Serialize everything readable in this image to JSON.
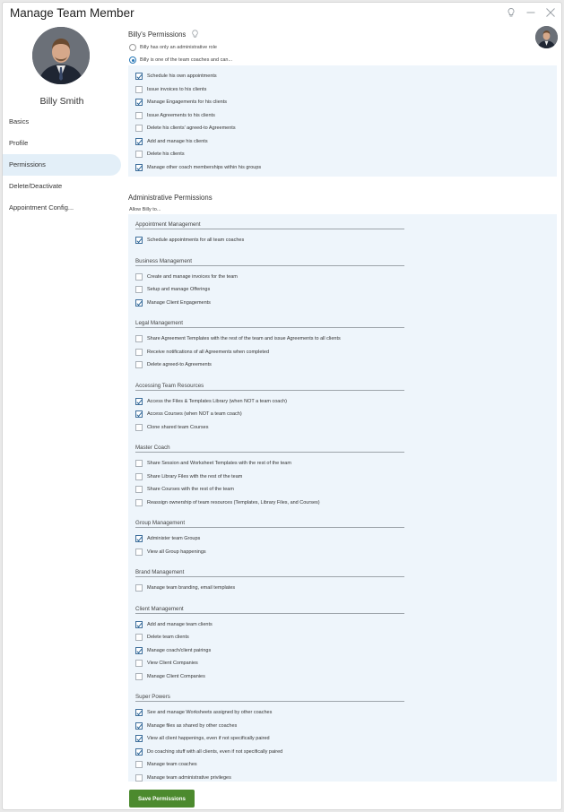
{
  "window": {
    "title": "Manage Team Member"
  },
  "user": {
    "name": "Billy Smith"
  },
  "nav": {
    "items": [
      "Basics",
      "Profile",
      "Permissions",
      "Delete/Deactivate",
      "Appointment Config..."
    ]
  },
  "coach_permissions": {
    "title": "Billy's Permissions",
    "radios": [
      {
        "label": "Billy has only an administrative role",
        "selected": false
      },
      {
        "label": "Billy is one of the team coaches and can...",
        "selected": true
      }
    ],
    "items": [
      {
        "label": "Schedule his own appointments",
        "checked": true
      },
      {
        "label": "Issue invoices to his clients",
        "checked": false
      },
      {
        "label": "Manage Engagements for his clients",
        "checked": true
      },
      {
        "label": "Issue Agreements to his clients",
        "checked": false
      },
      {
        "label": "Delete his clients' agreed-to Agreements",
        "checked": false
      },
      {
        "label": "Add and manage his clients",
        "checked": true
      },
      {
        "label": "Delete his clients",
        "checked": false
      },
      {
        "label": "Manage other coach memberships within his groups",
        "checked": true
      }
    ]
  },
  "admin_permissions": {
    "title": "Administrative Permissions",
    "subtitle": "Allow Billy to...",
    "groups": [
      {
        "name": "Appointment Management",
        "items": [
          {
            "label": "Schedule appointments for all team coaches",
            "checked": true
          }
        ]
      },
      {
        "name": "Business Management",
        "items": [
          {
            "label": "Create and manage invoices for the team",
            "checked": false
          },
          {
            "label": "Setup and manage Offerings",
            "checked": false
          },
          {
            "label": "Manage Client Engagements",
            "checked": true
          }
        ]
      },
      {
        "name": "Legal Management",
        "items": [
          {
            "label": "Share Agreement Templates with the rest of the team and issue Agreements to all clients",
            "checked": false
          },
          {
            "label": "Receive notifications of all Agreements when completed",
            "checked": false
          },
          {
            "label": "Delete agreed-to Agreements",
            "checked": false
          }
        ]
      },
      {
        "name": "Accessing Team Resources",
        "items": [
          {
            "label": "Access the Files & Templates Library (when NOT a team coach)",
            "checked": true
          },
          {
            "label": "Access Courses (when NOT a team coach)",
            "checked": true
          },
          {
            "label": "Clone shared team Courses",
            "checked": false
          }
        ]
      },
      {
        "name": "Master Coach",
        "items": [
          {
            "label": "Share Session and Worksheet Templates with the rest of the team",
            "checked": false
          },
          {
            "label": "Share Library Files with the rest of the team",
            "checked": false
          },
          {
            "label": "Share Courses with the rest of the team",
            "checked": false
          },
          {
            "label": "Reassign ownership of team resources (Templates, Library Files, and Courses)",
            "checked": false
          }
        ]
      },
      {
        "name": "Group Management",
        "items": [
          {
            "label": "Administer team Groups",
            "checked": true
          },
          {
            "label": "View all Group happenings",
            "checked": false
          }
        ]
      },
      {
        "name": "Brand Management",
        "items": [
          {
            "label": "Manage team branding, email templates",
            "checked": false
          }
        ]
      },
      {
        "name": "Client Management",
        "items": [
          {
            "label": "Add and manage team clients",
            "checked": true
          },
          {
            "label": "Delete team clients",
            "checked": false
          },
          {
            "label": "Manage coach/client pairings",
            "checked": true
          },
          {
            "label": "View Client Companies",
            "checked": false
          },
          {
            "label": "Manage Client Companies",
            "checked": false
          }
        ]
      },
      {
        "name": "Super Powers",
        "items": [
          {
            "label": "See and manage Worksheets assigned by other coaches",
            "checked": true
          },
          {
            "label": "Manage files as shared by other coaches",
            "checked": true
          },
          {
            "label": "View all client happenings, even if not specifically paired",
            "checked": true
          },
          {
            "label": "Do coaching stuff with all clients, even if not specifically paired",
            "checked": true
          },
          {
            "label": "Manage team coaches",
            "checked": false
          },
          {
            "label": "Manage team administrative privileges",
            "checked": false
          }
        ]
      }
    ]
  },
  "actions": {
    "save_label": "Save Permissions"
  },
  "colors": {
    "accent": "#2b79b7",
    "save_button": "#4c8a2e",
    "panel_bg": "#eef5fb",
    "nav_active_bg": "#e3eff8"
  },
  "icons": {
    "bulb": "lightbulb-icon",
    "minimize": "minimize-icon",
    "close": "close-icon"
  }
}
